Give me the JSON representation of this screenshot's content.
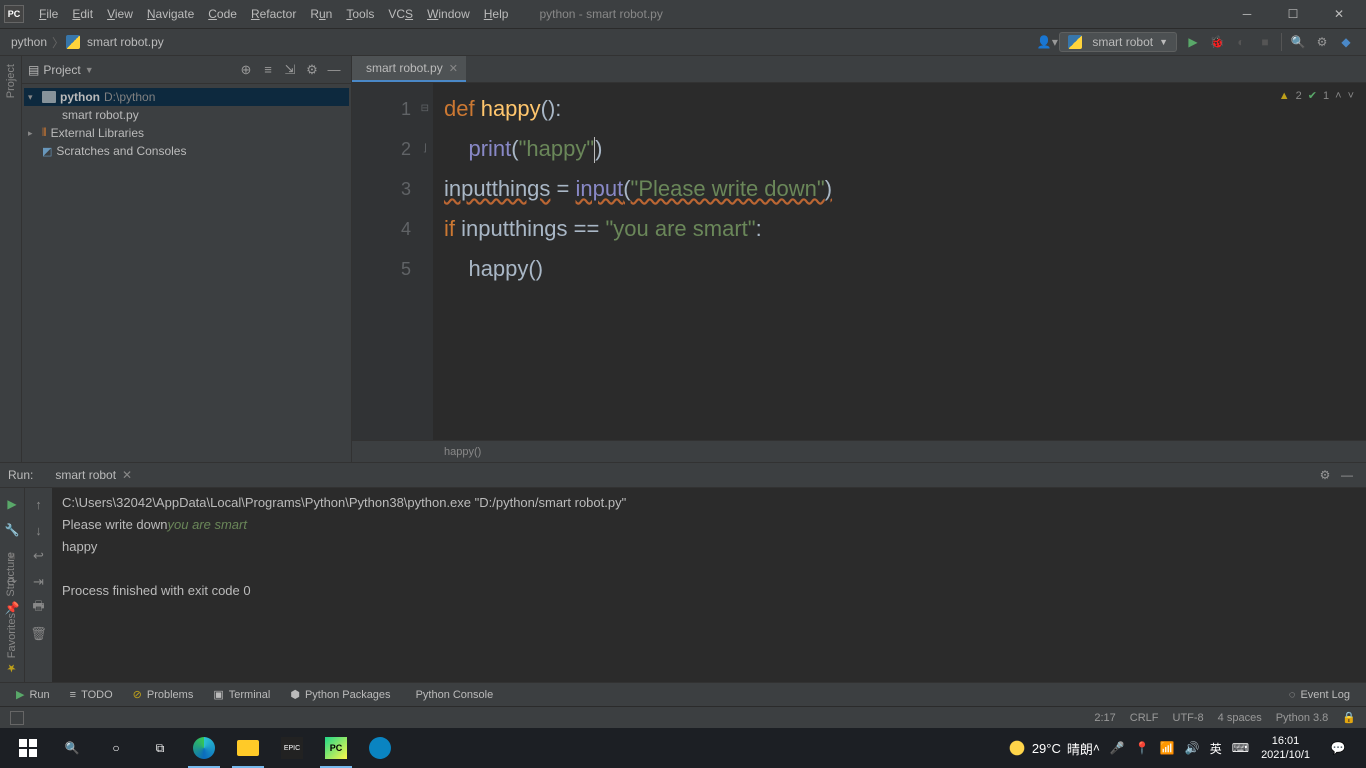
{
  "titlebar": {
    "app_badge": "PC",
    "menus": [
      "File",
      "Edit",
      "View",
      "Navigate",
      "Code",
      "Refactor",
      "Run",
      "Tools",
      "VCS",
      "Window",
      "Help"
    ],
    "title": "python - smart robot.py"
  },
  "breadcrumb": {
    "root": "python",
    "file": "smart robot.py"
  },
  "toolbar": {
    "run_config": "smart robot"
  },
  "project_panel": {
    "title": "Project",
    "tree": {
      "root_name": "python",
      "root_path": "D:\\python",
      "file": "smart robot.py",
      "ext_libs": "External Libraries",
      "scratches": "Scratches and Consoles"
    }
  },
  "editor": {
    "tab_name": "smart robot.py",
    "lines": [
      "1",
      "2",
      "3",
      "4",
      "5"
    ],
    "code_tokens": {
      "l1_def": "def ",
      "l1_fn": "happy",
      "l1_paren": "():",
      "l2_indent": "    ",
      "l2_print": "print",
      "l2_open": "(",
      "l2_str": "\"happy\"",
      "l2_close": ")",
      "l3_var": "inputthings",
      "l3_eq": " = ",
      "l3_input": "input",
      "l3_open": "(",
      "l3_str": "\"Please write down\"",
      "l3_close": ")",
      "l4_if": "if ",
      "l4_var": "inputthings",
      "l4_eq": " == ",
      "l4_str": "\"you are smart\"",
      "l4_colon": ":",
      "l5_indent": "    ",
      "l5_call": "happy",
      "l5_paren": "()"
    },
    "breadcrumb": "happy()",
    "inspection": {
      "warn_count": "2",
      "ok_count": "1"
    }
  },
  "run_panel": {
    "label": "Run:",
    "tab": "smart robot",
    "output": {
      "cmd": "C:\\Users\\32042\\AppData\\Local\\Programs\\Python\\Python38\\python.exe \"D:/python/smart robot.py\"",
      "prompt": "Please write down",
      "user_input": "you are smart",
      "result": "happy",
      "finished": "Process finished with exit code 0"
    }
  },
  "bottom_tools": {
    "run": "Run",
    "todo": "TODO",
    "problems": "Problems",
    "terminal": "Terminal",
    "packages": "Python Packages",
    "console": "Python Console",
    "event_log": "Event Log"
  },
  "statusbar": {
    "pos": "2:17",
    "eol": "CRLF",
    "encoding": "UTF-8",
    "indent": "4 spaces",
    "interpreter": "Python 3.8"
  },
  "taskbar": {
    "weather_temp": "29°C",
    "weather_text": "晴朗",
    "ime": "英",
    "time": "16:01",
    "date": "2021/10/1"
  },
  "side_labels": {
    "project": "Project",
    "structure": "Structure",
    "favorites": "Favorites"
  }
}
